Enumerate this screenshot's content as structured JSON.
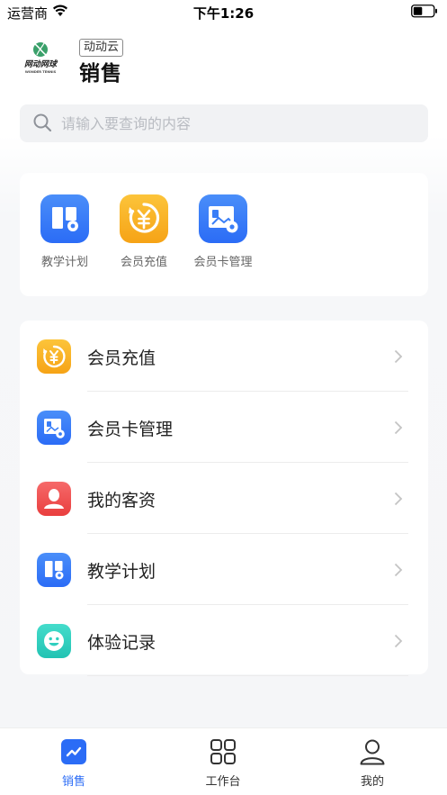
{
  "status_bar": {
    "carrier": "运营商",
    "time": "下午1:26"
  },
  "header": {
    "logo_text": "网动网球",
    "logo_subtext": "WONDER TENNIS",
    "tag": "动动云",
    "title": "销售"
  },
  "search": {
    "placeholder": "请输入要查询的内容",
    "value": ""
  },
  "quick_access": [
    {
      "label": "教学计划",
      "icon": "teaching-plan-icon"
    },
    {
      "label": "会员充值",
      "icon": "member-recharge-icon"
    },
    {
      "label": "会员卡管理",
      "icon": "member-card-icon"
    }
  ],
  "menu": [
    {
      "label": "会员充值",
      "icon": "member-recharge-icon"
    },
    {
      "label": "会员卡管理",
      "icon": "member-card-icon"
    },
    {
      "label": "我的客资",
      "icon": "my-clients-icon"
    },
    {
      "label": "教学计划",
      "icon": "teaching-plan-icon"
    },
    {
      "label": "体验记录",
      "icon": "trial-record-icon"
    }
  ],
  "tabs": [
    {
      "label": "销售",
      "icon": "sales-chart-icon",
      "active": true
    },
    {
      "label": "工作台",
      "icon": "workbench-grid-icon",
      "active": false
    },
    {
      "label": "我的",
      "icon": "profile-icon",
      "active": false
    }
  ],
  "colors": {
    "accent_blue": "#2b6cf6",
    "orange": "#f8a91c",
    "red": "#ef4a4a",
    "teal": "#2fcfbf"
  }
}
